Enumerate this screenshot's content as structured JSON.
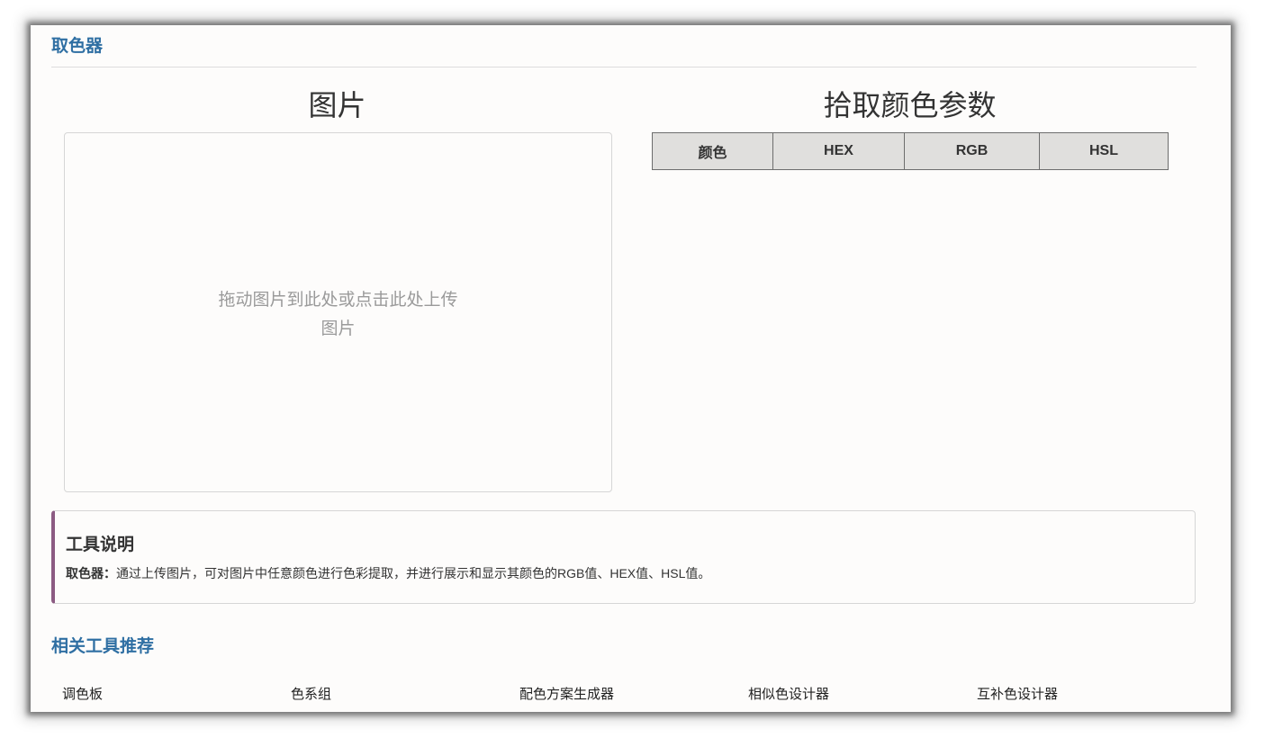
{
  "page_title": "取色器",
  "image_section": {
    "heading": "图片",
    "upload_hint_line1": "拖动图片到此处或点击此处上传",
    "upload_hint_line2": "图片"
  },
  "params_section": {
    "heading": "拾取颜色参数",
    "table_headers": [
      "颜色",
      "HEX",
      "RGB",
      "HSL"
    ]
  },
  "description": {
    "title": "工具说明",
    "label": "取色器：",
    "text": "通过上传图片，可对图片中任意颜色进行色彩提取，并进行展示和显示其颜色的RGB值、HEX值、HSL值。"
  },
  "related": {
    "title": "相关工具推荐",
    "links": [
      "调色板",
      "色系组",
      "配色方案生成器",
      "相似色设计器",
      "互补色设计器"
    ]
  },
  "colors": {
    "accent_blue": "#2f6fa3",
    "description_border": "#8c5b83",
    "table_header_bg": "#e0dfdd"
  }
}
